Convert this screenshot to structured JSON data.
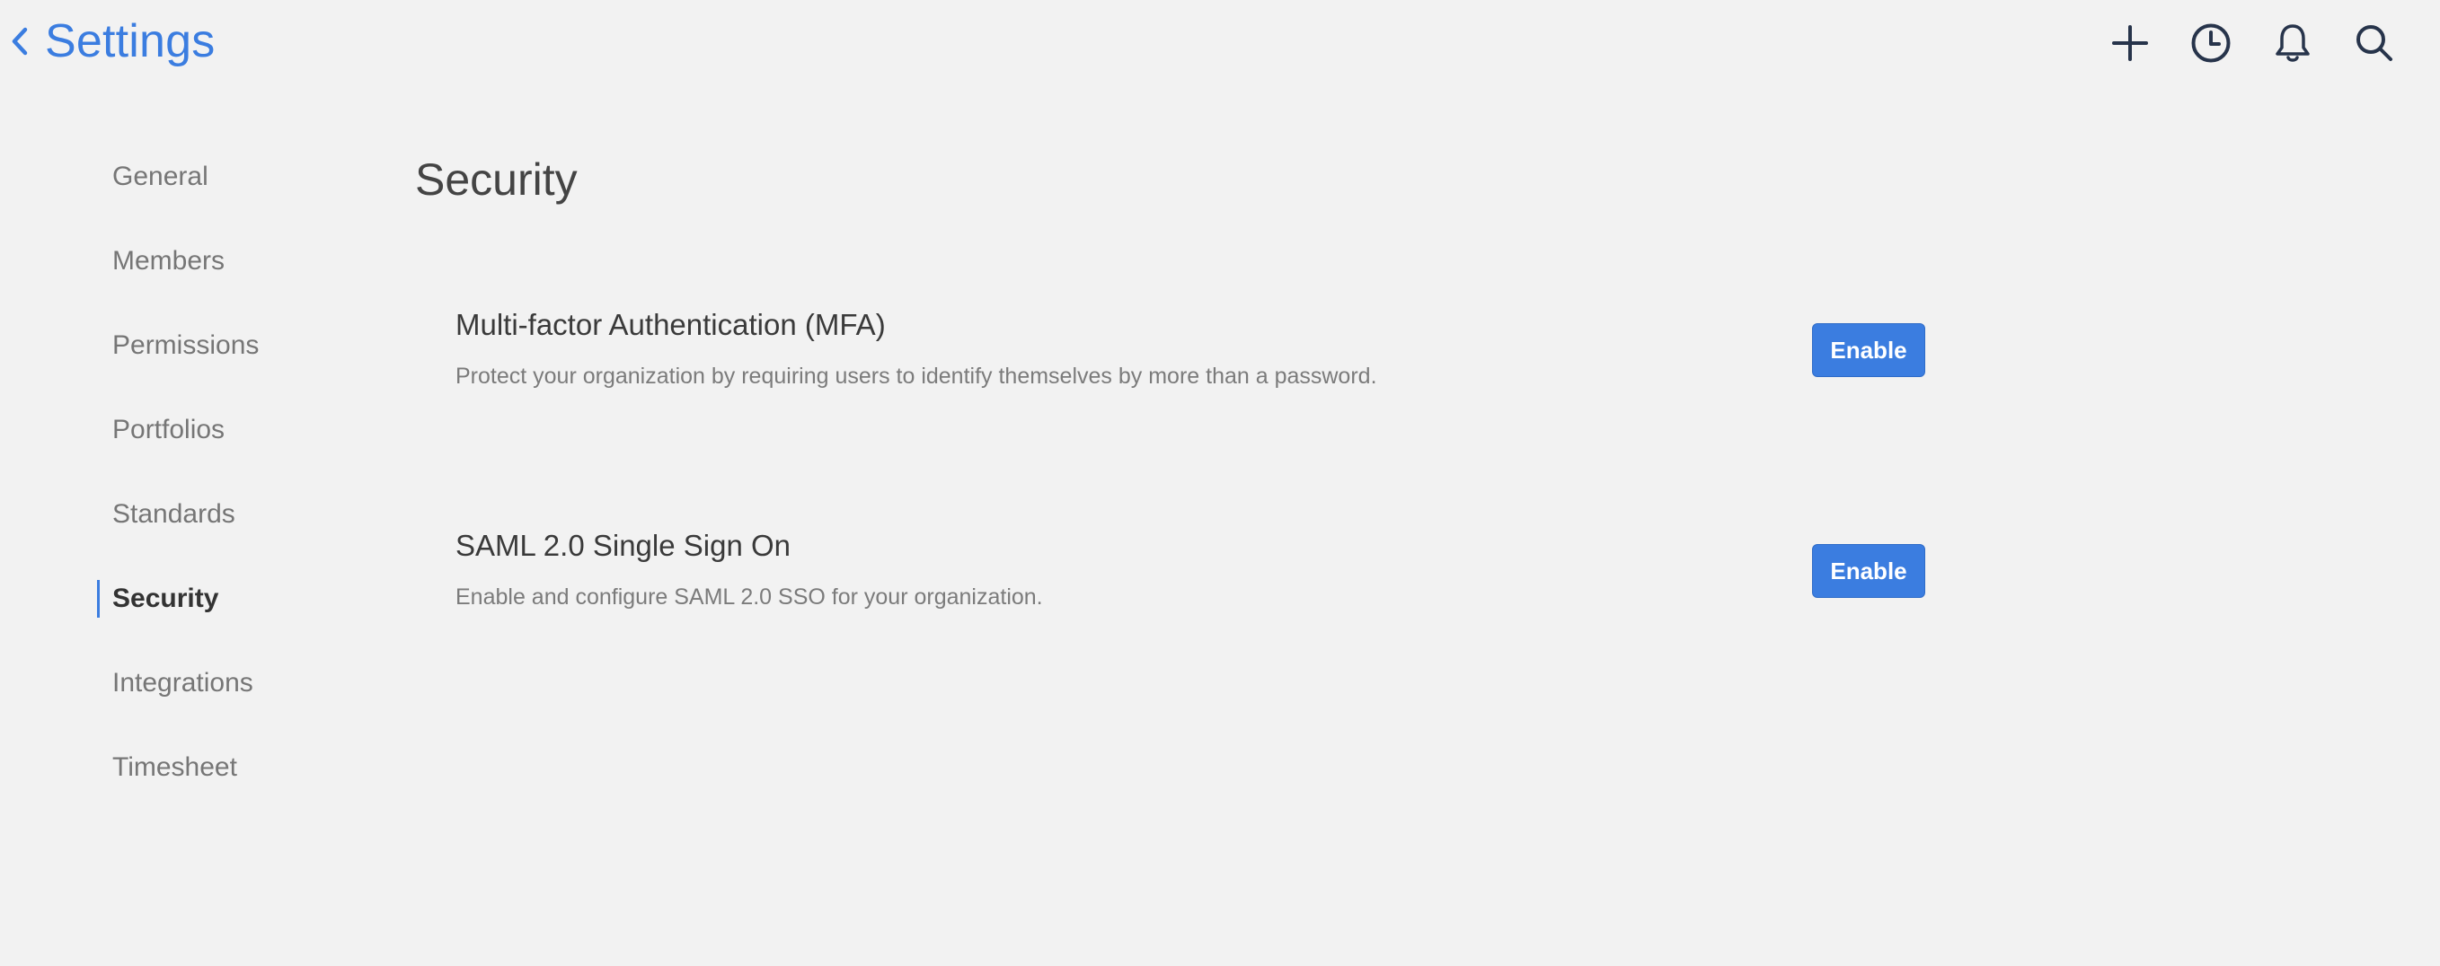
{
  "header": {
    "title": "Settings",
    "back_icon": "chevron-left-icon",
    "actions": [
      {
        "name": "add",
        "icon": "plus-icon"
      },
      {
        "name": "history",
        "icon": "clock-icon"
      },
      {
        "name": "notifications",
        "icon": "bell-icon"
      },
      {
        "name": "search",
        "icon": "search-icon"
      }
    ]
  },
  "sidebar": {
    "active": "Security",
    "items": [
      {
        "label": "General"
      },
      {
        "label": "Members"
      },
      {
        "label": "Permissions"
      },
      {
        "label": "Portfolios"
      },
      {
        "label": "Standards"
      },
      {
        "label": "Security"
      },
      {
        "label": "Integrations"
      },
      {
        "label": "Timesheet"
      }
    ]
  },
  "main": {
    "title": "Security",
    "settings": [
      {
        "title": "Multi-factor Authentication (MFA)",
        "description": "Protect your organization by requiring users to identify themselves by more than a password.",
        "button_label": "Enable"
      },
      {
        "title": "SAML 2.0 Single Sign On",
        "description": "Enable and configure SAML 2.0 SSO for your organization.",
        "button_label": "Enable"
      }
    ]
  },
  "colors": {
    "accent": "#3b7de0",
    "background": "#f2f2f2",
    "text": "#3d3d3d",
    "muted_text": "#767676",
    "icon": "#27344b"
  }
}
